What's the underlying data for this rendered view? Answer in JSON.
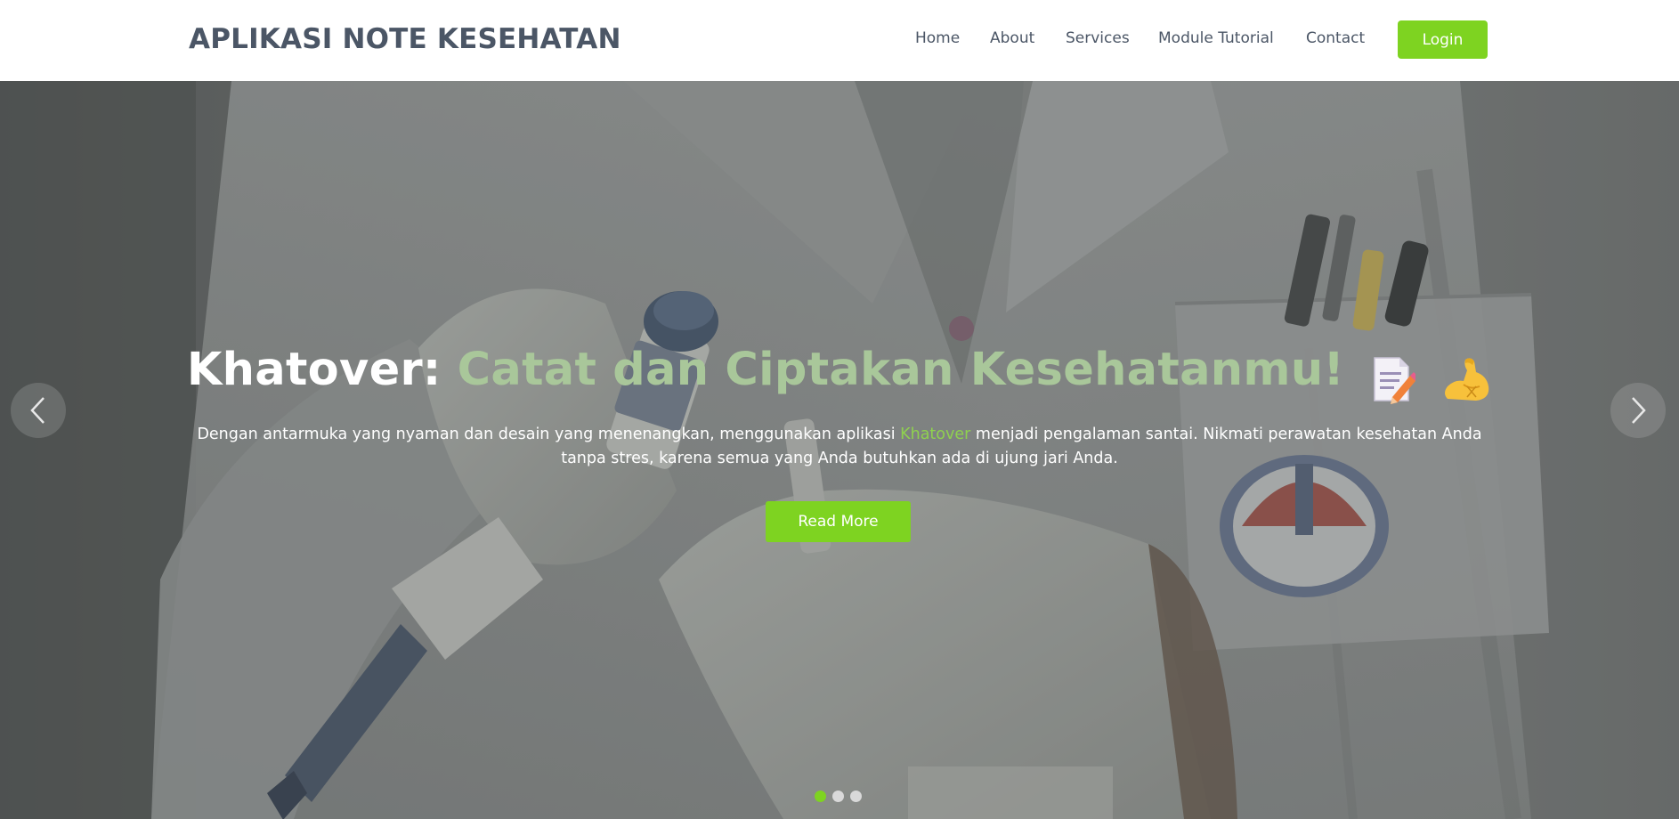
{
  "header": {
    "brand": "APLIKASI NOTE KESEHATAN",
    "nav": {
      "home": "Home",
      "about": "About",
      "services": "Services",
      "module_tutorial": "Module Tutorial",
      "contact": "Contact"
    },
    "login_label": "Login"
  },
  "hero": {
    "title_lead": "Khatover: ",
    "title_accent": "Catat dan Ciptakan Kesehatanmu!",
    "title_icons": [
      "memo-icon",
      "flexed-biceps-icon"
    ],
    "description_before": "Dengan antarmuka yang nyaman dan desain yang menenangkan, menggunakan aplikasi ",
    "description_highlight": "Khatover",
    "description_after": " menjadi pengalaman santai. Nikmati perawatan kesehatan Anda tanpa stres, karena semua yang Anda butuhkan ada di ujung jari Anda.",
    "cta_label": "Read More",
    "carousel": {
      "prev_icon": "chevron-left-icon",
      "next_icon": "chevron-right-icon",
      "slides_total": 3,
      "active_index": 0
    }
  },
  "colors": {
    "primary_green": "#7ed321",
    "nav_text": "#4b5666",
    "title_accent": "#a9c79a",
    "highlight": "#8fd14f",
    "dot_inactive": "#d9d9d9"
  }
}
